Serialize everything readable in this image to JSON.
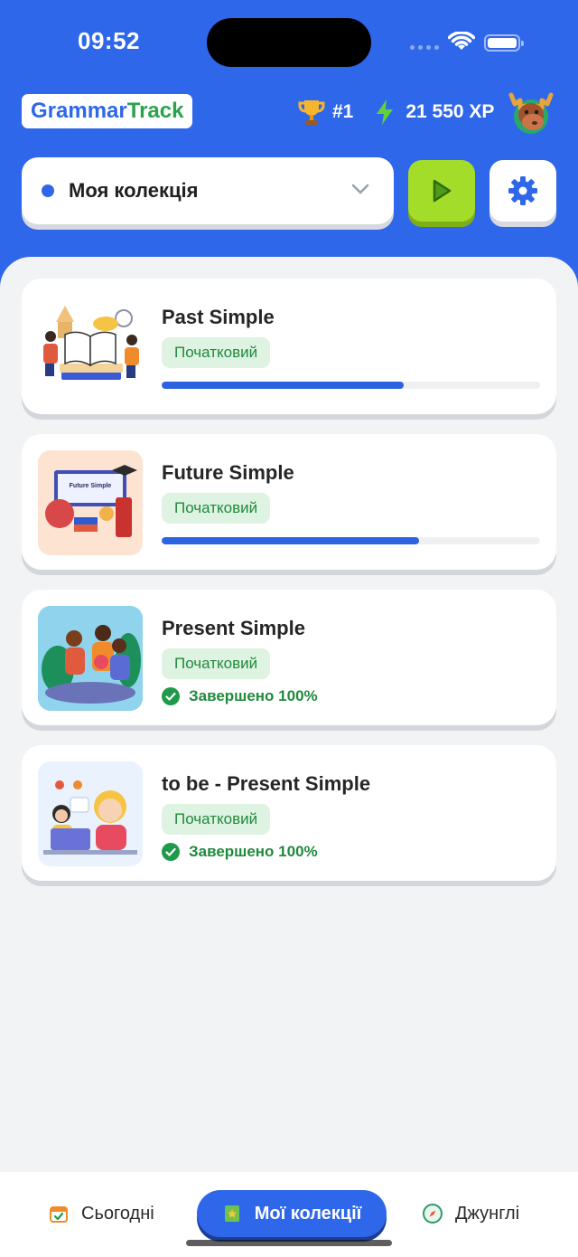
{
  "status_bar": {
    "time": "09:52"
  },
  "header": {
    "logo_part1": "Grammar",
    "logo_part2": "Track",
    "rank": "#1",
    "xp": "21 550 XP"
  },
  "controls": {
    "collection_label": "Моя колекція"
  },
  "cards": [
    {
      "title": "Past Simple",
      "level": "Початковий",
      "progress": 0.64,
      "completed": ""
    },
    {
      "title": "Future Simple",
      "level": "Початковий",
      "progress": 0.68,
      "completed": ""
    },
    {
      "title": "Present Simple",
      "level": "Початковий",
      "progress": 1.0,
      "completed": "Завершено 100%"
    },
    {
      "title": "to be - Present Simple",
      "level": "Початковий",
      "progress": 1.0,
      "completed": "Завершено 100%"
    }
  ],
  "thumbnail_text": {
    "future_simple_board": "Future Simple"
  },
  "bottom_nav": {
    "today": "Сьогодні",
    "my_collections": "Мої колекції",
    "jungle": "Джунглі"
  },
  "colors": {
    "brand_blue": "#2f67ea",
    "play_green": "#a4dc2a",
    "progress_blue": "#2b63e3",
    "badge_green": "#208a3c"
  }
}
